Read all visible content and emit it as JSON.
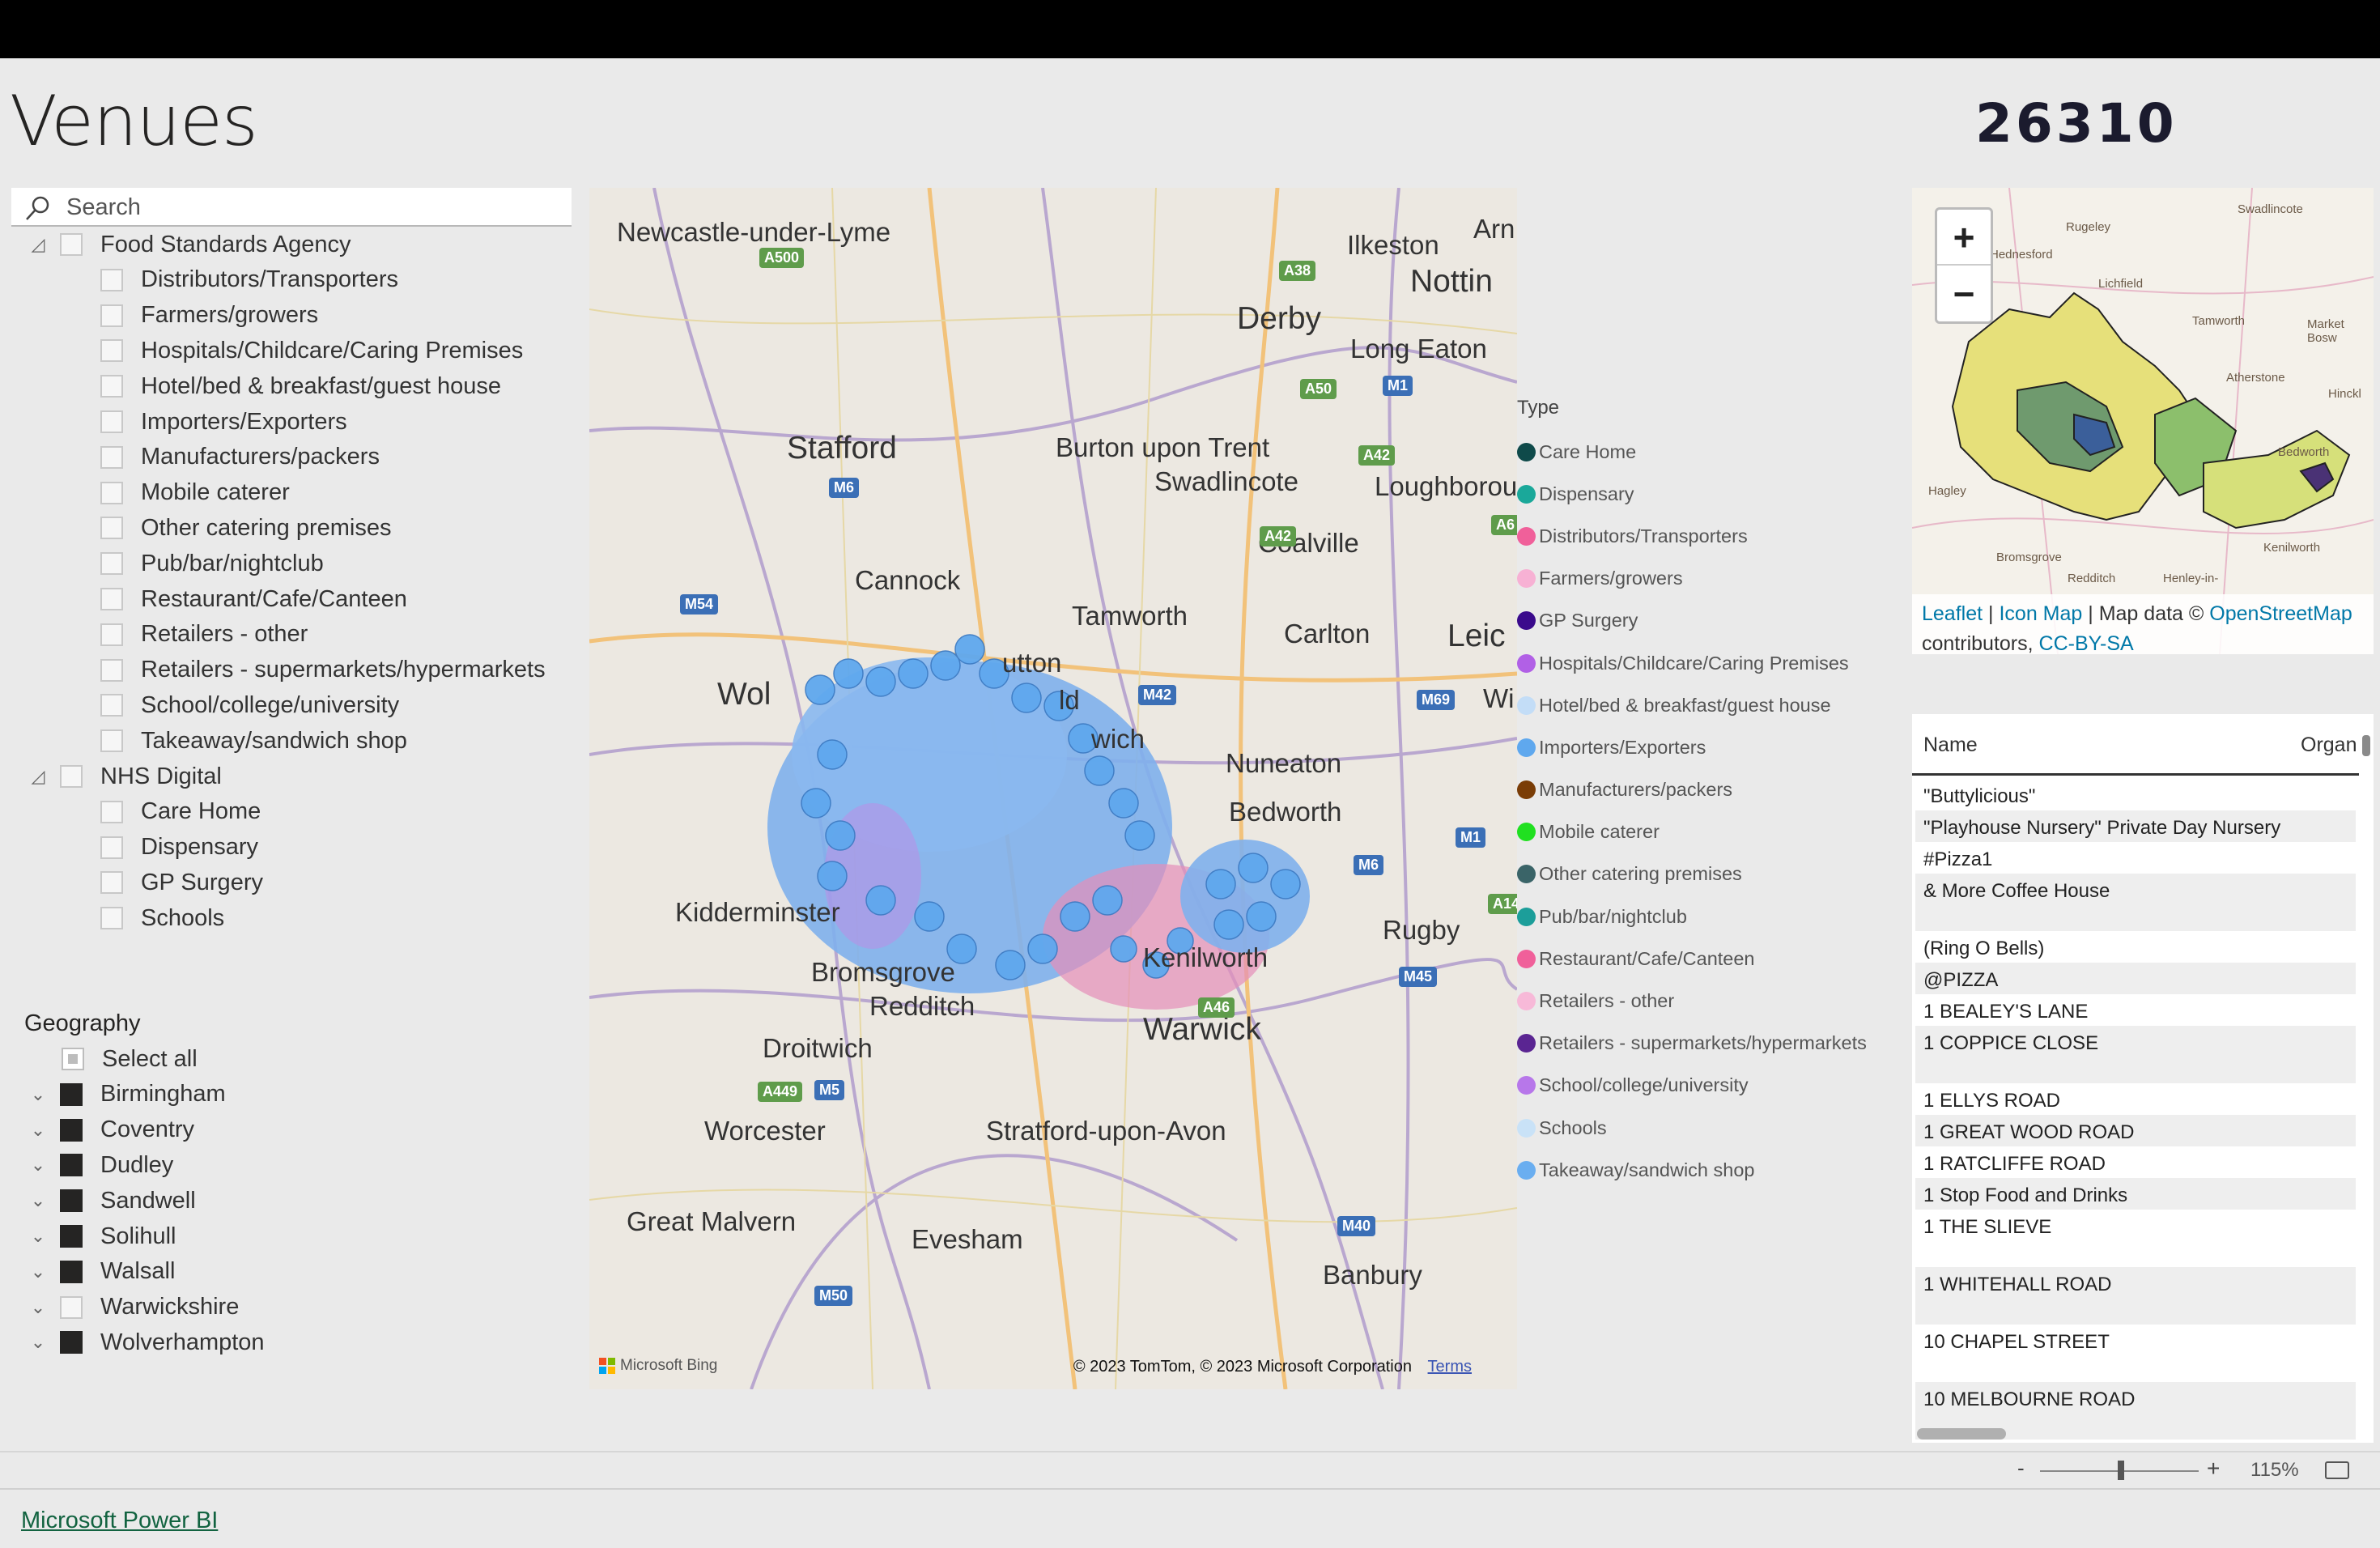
{
  "page": {
    "title": "Venues",
    "card_value": "26310"
  },
  "slicer": {
    "search_placeholder": "Search",
    "groups": [
      {
        "label": "Food Standards Agency",
        "items": [
          "Distributors/Transporters",
          "Farmers/growers",
          "Hospitals/Childcare/Caring Premises",
          "Hotel/bed & breakfast/guest house",
          "Importers/Exporters",
          "Manufacturers/packers",
          "Mobile caterer",
          "Other catering premises",
          "Pub/bar/nightclub",
          "Restaurant/Cafe/Canteen",
          "Retailers - other",
          "Retailers - supermarkets/hypermarkets",
          "School/college/university",
          "Takeaway/sandwich shop"
        ]
      },
      {
        "label": "NHS Digital",
        "items": [
          "Care Home",
          "Dispensary",
          "GP Surgery",
          "Schools"
        ]
      }
    ]
  },
  "geography": {
    "header": "Geography",
    "select_all": "Select all",
    "items": [
      {
        "label": "Birmingham",
        "checked": true
      },
      {
        "label": "Coventry",
        "checked": true
      },
      {
        "label": "Dudley",
        "checked": true
      },
      {
        "label": "Sandwell",
        "checked": true
      },
      {
        "label": "Solihull",
        "checked": true
      },
      {
        "label": "Walsall",
        "checked": true
      },
      {
        "label": "Warwickshire",
        "checked": false
      },
      {
        "label": "Wolverhampton",
        "checked": true
      }
    ]
  },
  "map": {
    "places": [
      "Newcastle-under-Lyme",
      "Ilkeston",
      "Arn",
      "Nottin",
      "Derby",
      "Long Eaton",
      "Stafford",
      "Burton upon Trent",
      "Swadlincote",
      "Loughborou",
      "Coalville",
      "Cannock",
      "Tamworth",
      "Carlton",
      "Leic",
      "Wol",
      "utton",
      "ld",
      "wich",
      "Wi",
      "Nuneaton",
      "Bedworth",
      "Kidderminster",
      "Bromsgrove",
      "Redditch",
      "Kenilworth",
      "Rugby",
      "Droitwich",
      "Warwick",
      "Worcester",
      "Stratford-upon-Avon",
      "Great Malvern",
      "Evesham",
      "Banbury"
    ],
    "roads": [
      "A500",
      "A38",
      "M1",
      "A50",
      "A42",
      "M6",
      "A42",
      "A6",
      "M54",
      "M42",
      "M69",
      "M1",
      "M6",
      "A14",
      "M45",
      "A46",
      "A449",
      "M5",
      "M40",
      "M50"
    ],
    "provider": "Microsoft Bing",
    "attribution": "© 2023 TomTom, © 2023 Microsoft Corporation",
    "terms": "Terms"
  },
  "legend": {
    "title": "Type",
    "items": [
      {
        "label": "Care Home",
        "color": "#0f4a4a"
      },
      {
        "label": "Dispensary",
        "color": "#1aa89a"
      },
      {
        "label": "Distributors/Transporters",
        "color": "#f0609a"
      },
      {
        "label": "Farmers/growers",
        "color": "#f7b1d4"
      },
      {
        "label": "GP Surgery",
        "color": "#3a0a8c"
      },
      {
        "label": "Hospitals/Childcare/Caring Premises",
        "color": "#b160e6"
      },
      {
        "label": "Hotel/bed & breakfast/guest house",
        "color": "#c3ddf7"
      },
      {
        "label": "Importers/Exporters",
        "color": "#5fa8ee"
      },
      {
        "label": "Manufacturers/packers",
        "color": "#7a3d07"
      },
      {
        "label": "Mobile caterer",
        "color": "#20e020"
      },
      {
        "label": "Other catering premises",
        "color": "#3a6468"
      },
      {
        "label": "Pub/bar/nightclub",
        "color": "#1c9e9a"
      },
      {
        "label": "Restaurant/Cafe/Canteen",
        "color": "#f0609a"
      },
      {
        "label": "Retailers - other",
        "color": "#f7b9d8"
      },
      {
        "label": "Retailers - supermarkets/hypermarkets",
        "color": "#5a2592"
      },
      {
        "label": "School/college/university",
        "color": "#b777ea"
      },
      {
        "label": "Schools",
        "color": "#c9e2f7"
      },
      {
        "label": "Takeaway/sandwich shop",
        "color": "#6aaef0"
      }
    ]
  },
  "mini_map": {
    "zoom_in": "+",
    "zoom_out": "−",
    "places": [
      "Swadlincote",
      "Rugeley",
      "Hednesford",
      "Lichfield",
      "Tamworth",
      "Market Bosw",
      "Atherstone",
      "Hinckl",
      "Hagley",
      "Bedworth",
      "Bromsgrove",
      "Kenilworth",
      "Redditch",
      "Henley-in-"
    ],
    "attribution": {
      "leaflet": "Leaflet",
      "sep1": "|",
      "icon_map": "Icon Map",
      "sep2": "| Map data ©",
      "osm": "OpenStreetMap",
      "contributors": "contributors,",
      "license": "CC-BY-SA"
    }
  },
  "table": {
    "columns": [
      "Name",
      "Organ"
    ],
    "rows": [
      "\"Buttylicious\"",
      "\"Playhouse Nursery\" Private Day Nursery",
      "#Pizza1",
      "& More Coffee House",
      "(Ring O Bells)",
      "@PIZZA",
      "1 BEALEY'S LANE",
      "1 COPPICE CLOSE",
      "1 ELLYS ROAD",
      "1 GREAT WOOD ROAD",
      "1 RATCLIFFE ROAD",
      "1 Stop Food and Drinks",
      "1 THE SLIEVE",
      "1 WHITEHALL ROAD",
      "10 CHAPEL STREET",
      "10 MELBOURNE ROAD"
    ]
  },
  "zoom_bar": {
    "minus": "-",
    "plus": "+",
    "percent": "115%",
    "zoom_level": 1.15
  },
  "footer": {
    "link": "Microsoft Power BI"
  }
}
